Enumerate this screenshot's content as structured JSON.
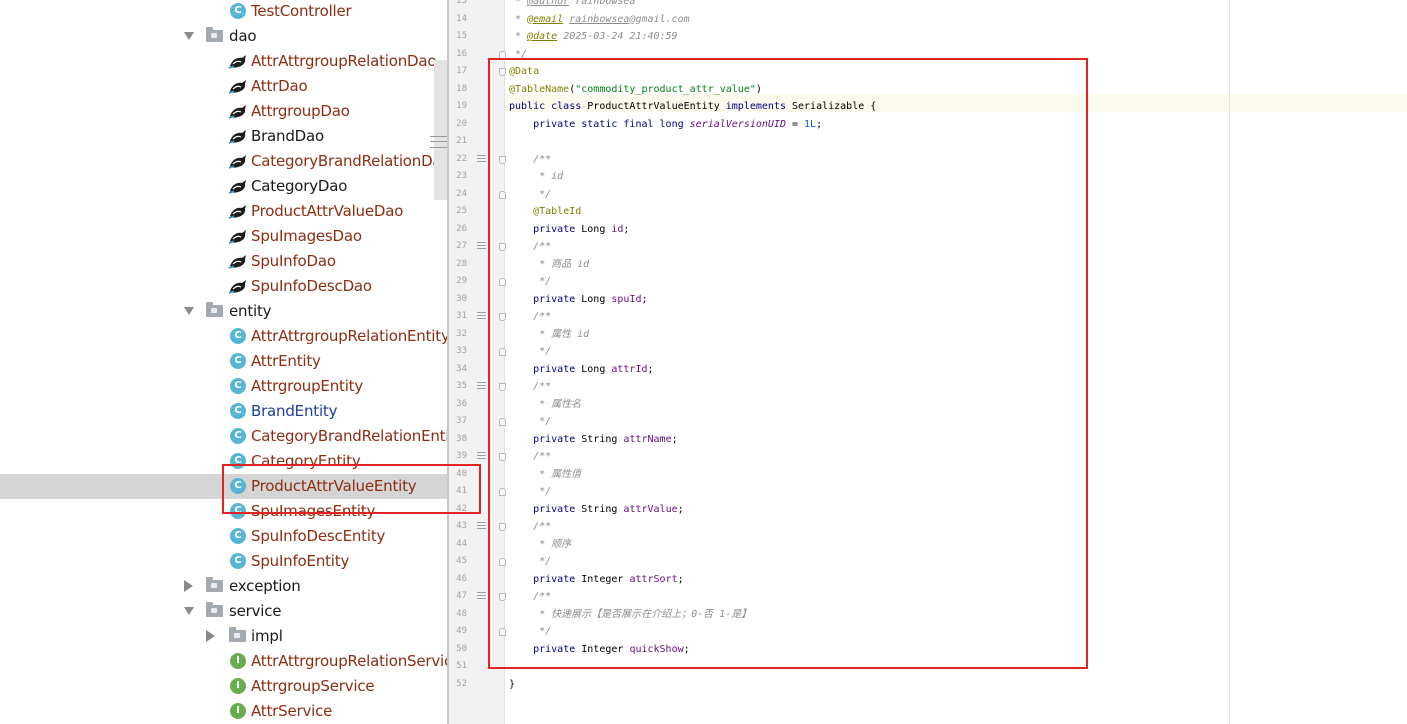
{
  "tree": {
    "items": [
      {
        "label": "TestController",
        "kind": "class",
        "depth": 2,
        "color": "red"
      },
      {
        "label": "dao",
        "kind": "folder",
        "depth": 1,
        "expanded": true
      },
      {
        "label": "AttrAttrgroupRelationDao",
        "kind": "dao",
        "depth": 2,
        "color": "red"
      },
      {
        "label": "AttrDao",
        "kind": "dao",
        "depth": 2,
        "color": "red"
      },
      {
        "label": "AttrgroupDao",
        "kind": "dao",
        "depth": 2,
        "color": "red"
      },
      {
        "label": "BrandDao",
        "kind": "dao",
        "depth": 2,
        "color": "black"
      },
      {
        "label": "CategoryBrandRelationDao",
        "kind": "dao",
        "depth": 2,
        "color": "red"
      },
      {
        "label": "CategoryDao",
        "kind": "dao",
        "depth": 2,
        "color": "black"
      },
      {
        "label": "ProductAttrValueDao",
        "kind": "dao",
        "depth": 2,
        "color": "red"
      },
      {
        "label": "SpuImagesDao",
        "kind": "dao",
        "depth": 2,
        "color": "red"
      },
      {
        "label": "SpuInfoDao",
        "kind": "dao",
        "depth": 2,
        "color": "red"
      },
      {
        "label": "SpuInfoDescDao",
        "kind": "dao",
        "depth": 2,
        "color": "red"
      },
      {
        "label": "entity",
        "kind": "folder",
        "depth": 1,
        "expanded": true
      },
      {
        "label": "AttrAttrgroupRelationEntity",
        "kind": "class",
        "depth": 2,
        "color": "red"
      },
      {
        "label": "AttrEntity",
        "kind": "class",
        "depth": 2,
        "color": "red"
      },
      {
        "label": "AttrgroupEntity",
        "kind": "class",
        "depth": 2,
        "color": "red"
      },
      {
        "label": "BrandEntity",
        "kind": "class",
        "depth": 2,
        "color": "blue"
      },
      {
        "label": "CategoryBrandRelationEntity",
        "kind": "class",
        "depth": 2,
        "color": "red"
      },
      {
        "label": "CategoryEntity",
        "kind": "class",
        "depth": 2,
        "color": "red"
      },
      {
        "label": "ProductAttrValueEntity",
        "kind": "class",
        "depth": 2,
        "color": "red",
        "selected": true
      },
      {
        "label": "SpuImagesEntity",
        "kind": "class",
        "depth": 2,
        "color": "red"
      },
      {
        "label": "SpuInfoDescEntity",
        "kind": "class",
        "depth": 2,
        "color": "red"
      },
      {
        "label": "SpuInfoEntity",
        "kind": "class",
        "depth": 2,
        "color": "red"
      },
      {
        "label": "exception",
        "kind": "folder",
        "depth": 1,
        "expanded": false
      },
      {
        "label": "service",
        "kind": "folder",
        "depth": 1,
        "expanded": true
      },
      {
        "label": "impl",
        "kind": "folder",
        "depth": 2,
        "expanded": false
      },
      {
        "label": "AttrAttrgroupRelationService",
        "kind": "interface",
        "depth": 2,
        "color": "red"
      },
      {
        "label": "AttrgroupService",
        "kind": "interface",
        "depth": 2,
        "color": "red"
      },
      {
        "label": "AttrService",
        "kind": "interface",
        "depth": 2,
        "color": "red"
      }
    ]
  },
  "icons": {
    "class": "C",
    "interface": "I",
    "dao": "mybatis-bird-icon",
    "folder": "package-folder-icon"
  },
  "colors": {
    "red": "#8b2e12",
    "black": "#1a1a1a",
    "blue": "#1b3f9c",
    "highlight": "#e02424"
  },
  "editor": {
    "lines": [
      {
        "n": "13",
        "tokens": [
          [
            "cm",
            " * "
          ],
          [
            "tgv",
            "@author"
          ],
          [
            "cm",
            " rainbowsea"
          ]
        ]
      },
      {
        "n": "14",
        "tokens": [
          [
            "cm",
            " * "
          ],
          [
            "tg",
            "@email"
          ],
          [
            "cm",
            " "
          ],
          [
            "tgv",
            "rainbowsea"
          ],
          [
            "cm",
            "@gmail.com"
          ]
        ]
      },
      {
        "n": "15",
        "tokens": [
          [
            "cm",
            " * "
          ],
          [
            "tg",
            "@date"
          ],
          [
            "cm",
            " 2025-03-24 21:40:59"
          ]
        ]
      },
      {
        "n": "16",
        "tokens": [
          [
            "cm",
            " */"
          ]
        ]
      },
      {
        "n": "17",
        "tokens": [
          [
            "an",
            "@Data"
          ]
        ]
      },
      {
        "n": "18",
        "tokens": [
          [
            "an",
            "@TableName"
          ],
          [
            "",
            "("
          ],
          [
            "st",
            "\"commodity_product_attr_value\""
          ],
          [
            "",
            ")"
          ]
        ]
      },
      {
        "n": "19",
        "tokens": [
          [
            "kw",
            "public class "
          ],
          [
            "",
            "ProductAttrValueEntity "
          ],
          [
            "kw",
            "implements "
          ],
          [
            "",
            "Serializable {"
          ]
        ]
      },
      {
        "n": "20",
        "tokens": [
          [
            "",
            "    "
          ],
          [
            "kw",
            "private static final long "
          ],
          [
            "fi",
            "serialVersionUID"
          ],
          [
            "",
            " = "
          ],
          [
            "nm",
            "1L"
          ],
          [
            "",
            ";"
          ]
        ]
      },
      {
        "n": "21",
        "tokens": []
      },
      {
        "n": "22",
        "tokens": [
          [
            "cm",
            "    /**"
          ]
        ]
      },
      {
        "n": "23",
        "tokens": [
          [
            "cm",
            "     * id"
          ]
        ]
      },
      {
        "n": "24",
        "tokens": [
          [
            "cm",
            "     */"
          ]
        ]
      },
      {
        "n": "25",
        "tokens": [
          [
            "",
            "    "
          ],
          [
            "an",
            "@TableId"
          ]
        ]
      },
      {
        "n": "26",
        "tokens": [
          [
            "",
            "    "
          ],
          [
            "kw",
            "private "
          ],
          [
            "",
            "Long "
          ],
          [
            "fd",
            "id"
          ],
          [
            "",
            ";"
          ]
        ]
      },
      {
        "n": "27",
        "tokens": [
          [
            "cm",
            "    /**"
          ]
        ]
      },
      {
        "n": "28",
        "tokens": [
          [
            "cm",
            "     * 商品 id"
          ]
        ]
      },
      {
        "n": "29",
        "tokens": [
          [
            "cm",
            "     */"
          ]
        ]
      },
      {
        "n": "30",
        "tokens": [
          [
            "",
            "    "
          ],
          [
            "kw",
            "private "
          ],
          [
            "",
            "Long "
          ],
          [
            "fd",
            "spuId"
          ],
          [
            "",
            ";"
          ]
        ]
      },
      {
        "n": "31",
        "tokens": [
          [
            "cm",
            "    /**"
          ]
        ]
      },
      {
        "n": "32",
        "tokens": [
          [
            "cm",
            "     * 属性 id"
          ]
        ]
      },
      {
        "n": "33",
        "tokens": [
          [
            "cm",
            "     */"
          ]
        ]
      },
      {
        "n": "34",
        "tokens": [
          [
            "",
            "    "
          ],
          [
            "kw",
            "private "
          ],
          [
            "",
            "Long "
          ],
          [
            "fd",
            "attrId"
          ],
          [
            "",
            ";"
          ]
        ]
      },
      {
        "n": "35",
        "tokens": [
          [
            "cm",
            "    /**"
          ]
        ]
      },
      {
        "n": "36",
        "tokens": [
          [
            "cm",
            "     * 属性名"
          ]
        ]
      },
      {
        "n": "37",
        "tokens": [
          [
            "cm",
            "     */"
          ]
        ]
      },
      {
        "n": "38",
        "tokens": [
          [
            "",
            "    "
          ],
          [
            "kw",
            "private "
          ],
          [
            "",
            "String "
          ],
          [
            "fd",
            "attrName"
          ],
          [
            "",
            ";"
          ]
        ]
      },
      {
        "n": "39",
        "tokens": [
          [
            "cm",
            "    /**"
          ]
        ]
      },
      {
        "n": "40",
        "tokens": [
          [
            "cm",
            "     * 属性值"
          ]
        ]
      },
      {
        "n": "41",
        "tokens": [
          [
            "cm",
            "     */"
          ]
        ]
      },
      {
        "n": "42",
        "tokens": [
          [
            "",
            "    "
          ],
          [
            "kw",
            "private "
          ],
          [
            "",
            "String "
          ],
          [
            "fd",
            "attrValue"
          ],
          [
            "",
            ";"
          ]
        ]
      },
      {
        "n": "43",
        "tokens": [
          [
            "cm",
            "    /**"
          ]
        ]
      },
      {
        "n": "44",
        "tokens": [
          [
            "cm",
            "     * 顺序"
          ]
        ]
      },
      {
        "n": "45",
        "tokens": [
          [
            "cm",
            "     */"
          ]
        ]
      },
      {
        "n": "46",
        "tokens": [
          [
            "",
            "    "
          ],
          [
            "kw",
            "private "
          ],
          [
            "",
            "Integer "
          ],
          [
            "fd",
            "attrSort"
          ],
          [
            "",
            ";"
          ]
        ]
      },
      {
        "n": "47",
        "tokens": [
          [
            "cm",
            "    /**"
          ]
        ]
      },
      {
        "n": "48",
        "tokens": [
          [
            "cm",
            "     * 快速展示【是否展示在介绍上；0-否 1-是】"
          ]
        ]
      },
      {
        "n": "49",
        "tokens": [
          [
            "cm",
            "     */"
          ]
        ]
      },
      {
        "n": "50",
        "tokens": [
          [
            "",
            "    "
          ],
          [
            "kw",
            "private "
          ],
          [
            "",
            "Integer "
          ],
          [
            "fd",
            "quickShow"
          ],
          [
            "",
            ";"
          ]
        ]
      },
      {
        "n": "51",
        "tokens": []
      },
      {
        "n": "52",
        "tokens": [
          [
            "",
            "}"
          ]
        ]
      }
    ]
  }
}
